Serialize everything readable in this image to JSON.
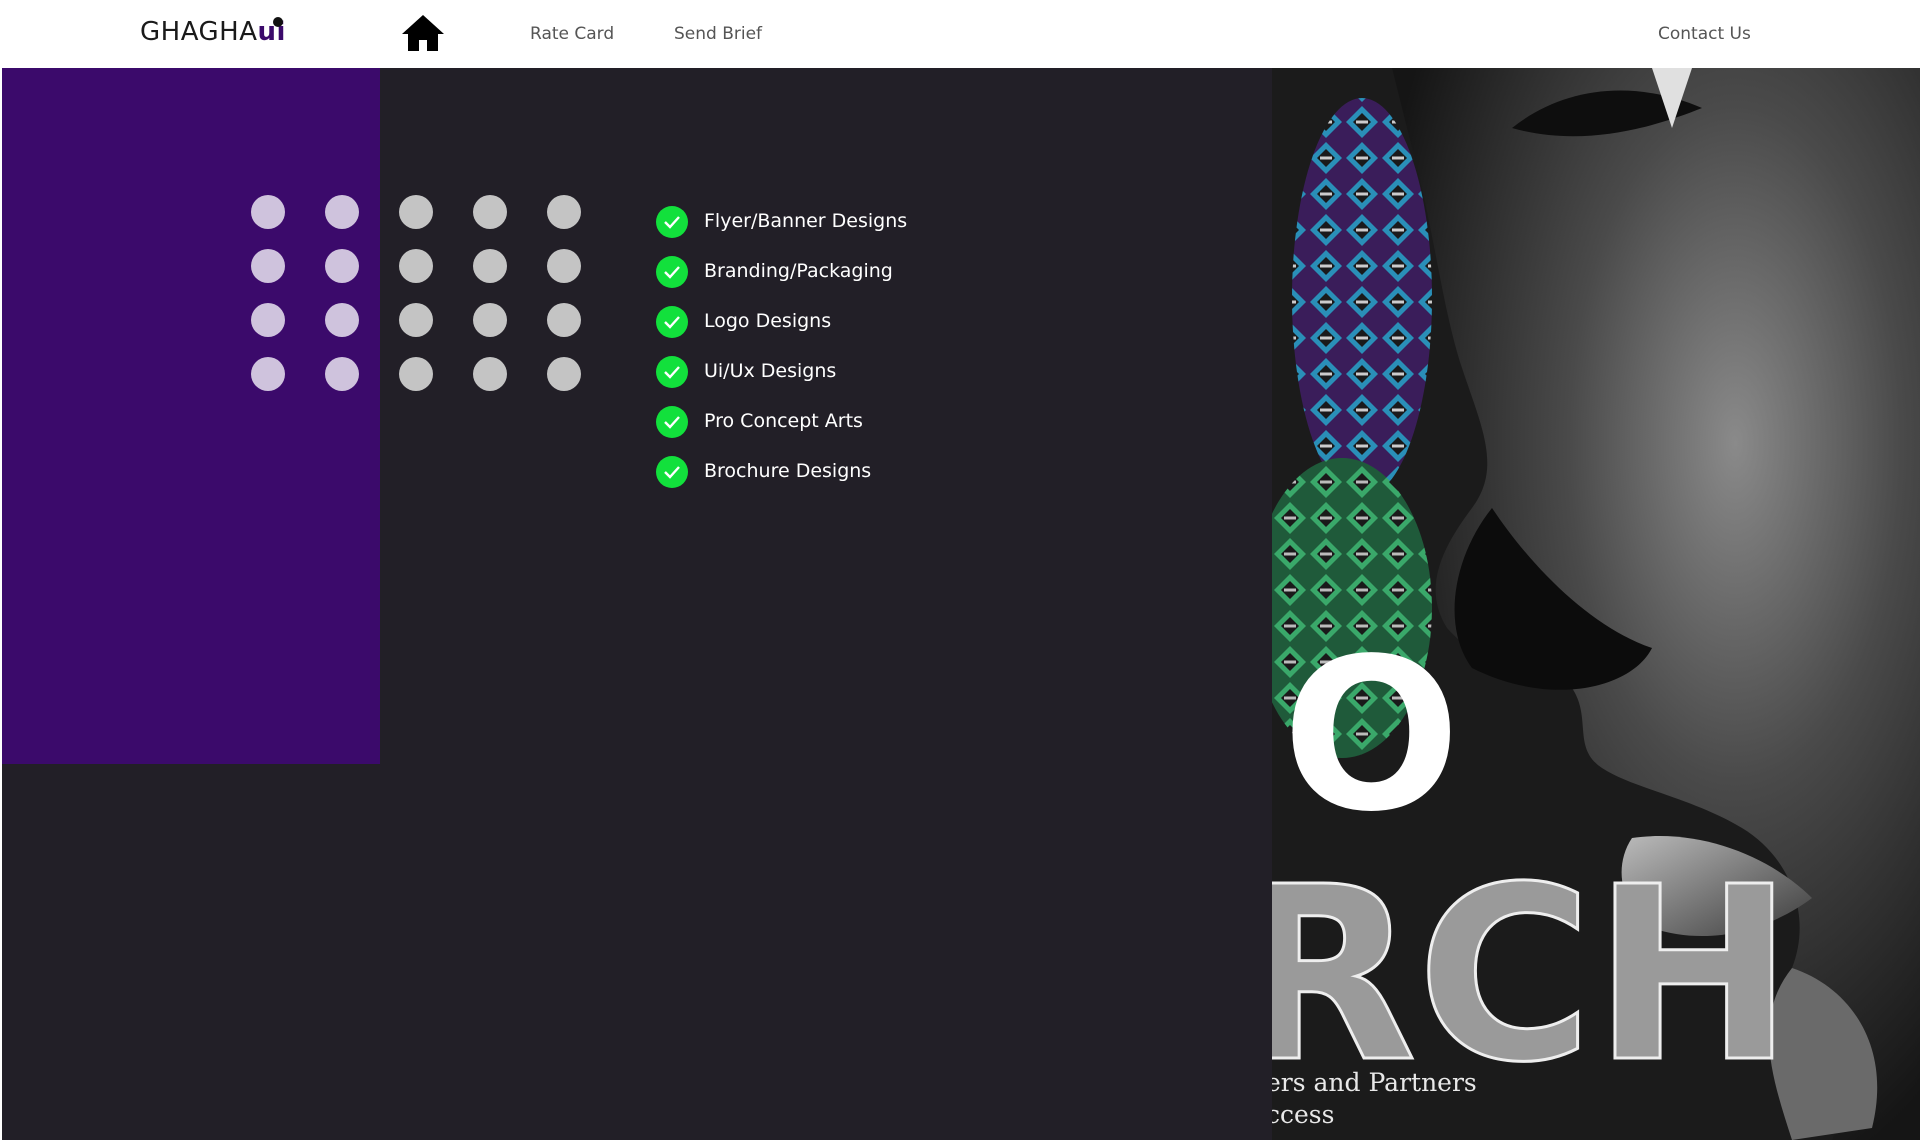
{
  "header": {
    "logo_main": "GHAGHA",
    "logo_accent": "ui",
    "nav": {
      "home_icon": "home-icon",
      "rate_card": "Rate Card",
      "send_brief": "Send Brief",
      "contact_us": "Contact Us"
    }
  },
  "services": [
    {
      "label": "Flyer/Banner Designs",
      "icon": "check-circle-icon"
    },
    {
      "label": "Branding/Packaging",
      "icon": "check-circle-icon"
    },
    {
      "label": "Logo Designs",
      "icon": "check-circle-icon"
    },
    {
      "label": "Ui/Ux Designs",
      "icon": "check-circle-icon"
    },
    {
      "label": "Pro Concept Arts",
      "icon": "check-circle-icon"
    },
    {
      "label": "Brochure Designs",
      "icon": "check-circle-icon"
    }
  ],
  "poster": {
    "line1": "ers and Partners",
    "line2": "ccess"
  },
  "colors": {
    "brand_purple": "#3b0a6b",
    "main_bg": "#221f27",
    "check_green": "#12e03c",
    "dot_light": "#cfc3dd",
    "dot_grey": "#c4c4c4"
  }
}
